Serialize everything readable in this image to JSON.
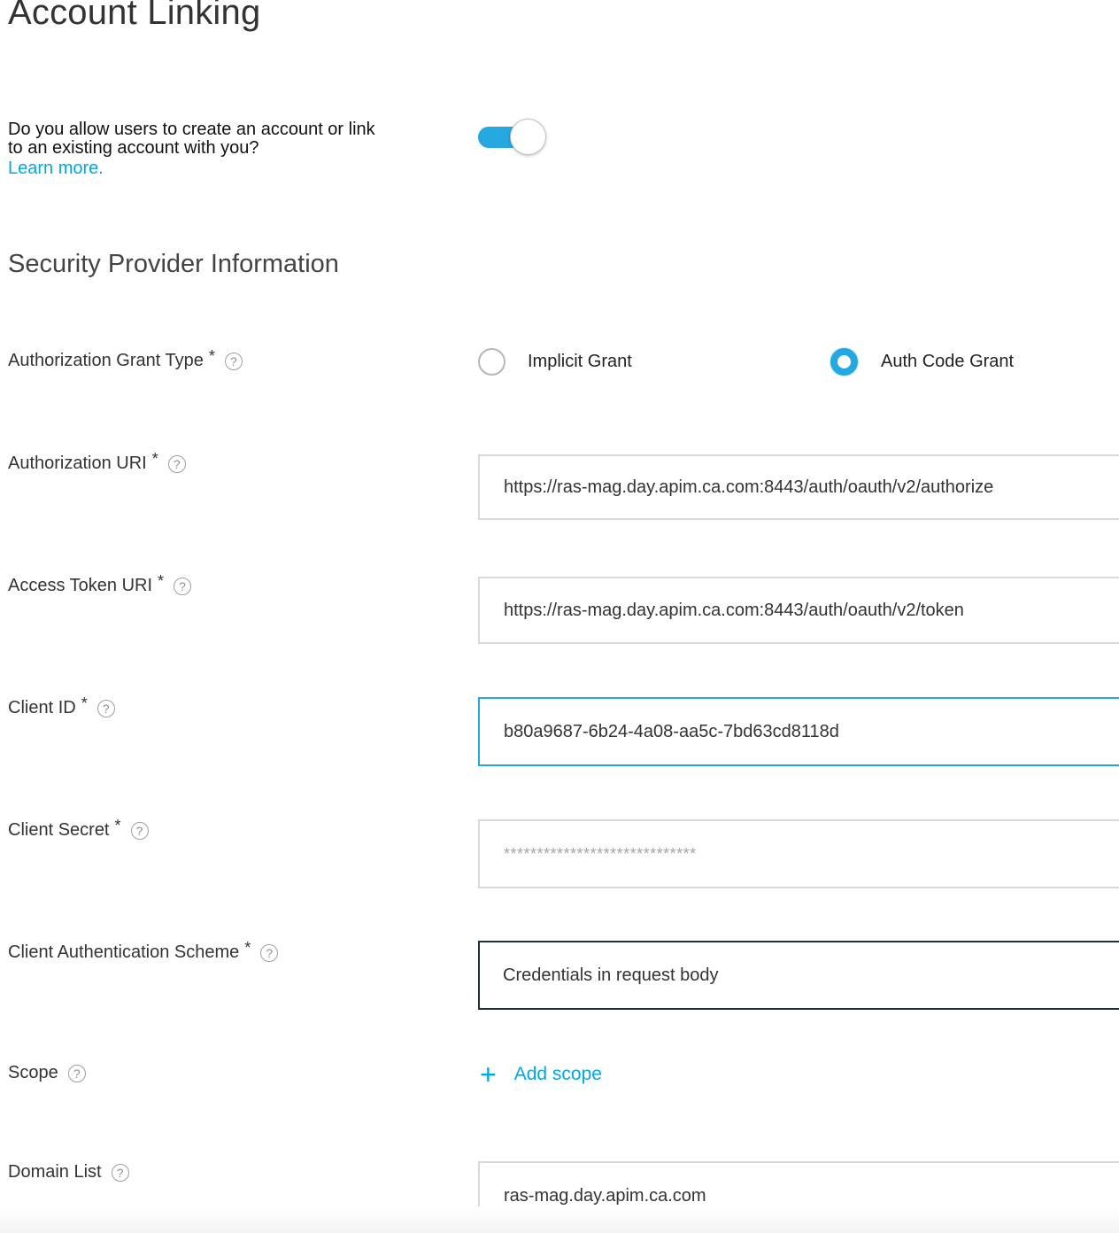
{
  "header": {
    "title": "Account Linking"
  },
  "linking": {
    "question": "Do you allow users to create an account or link to an existing account with you?",
    "learn_more": "Learn more",
    "learn_more_suffix": ".",
    "toggle_on": true
  },
  "security": {
    "title": "Security Provider Information",
    "grant_type": {
      "label": "Authorization Grant Type",
      "required": "*",
      "options": [
        {
          "label": "Implicit Grant",
          "selected": false
        },
        {
          "label": "Auth Code Grant",
          "selected": true
        }
      ]
    },
    "authorization_uri": {
      "label": "Authorization URI",
      "required": "*",
      "value": "https://ras-mag.day.apim.ca.com:8443/auth/oauth/v2/authorize"
    },
    "access_token_uri": {
      "label": "Access Token URI",
      "required": "*",
      "value": "https://ras-mag.day.apim.ca.com:8443/auth/oauth/v2/token"
    },
    "client_id": {
      "label": "Client ID",
      "required": "*",
      "value": "b80a9687-6b24-4a08-aa5c-7bd63cd8118d"
    },
    "client_secret": {
      "label": "Client Secret",
      "required": "*",
      "value": "*****************************"
    },
    "auth_scheme": {
      "label": "Client Authentication Scheme",
      "required": "*",
      "value": "Credentials in request body"
    },
    "scope": {
      "label": "Scope",
      "add_label": "Add scope"
    },
    "domain_list": {
      "label": "Domain List",
      "value": "ras-mag.day.apim.ca.com"
    }
  },
  "help_glyph": "?",
  "colors": {
    "accent": "#25a8e0",
    "link": "#00a8e1",
    "text": "#333333",
    "input_border": "#d5dbdb"
  }
}
